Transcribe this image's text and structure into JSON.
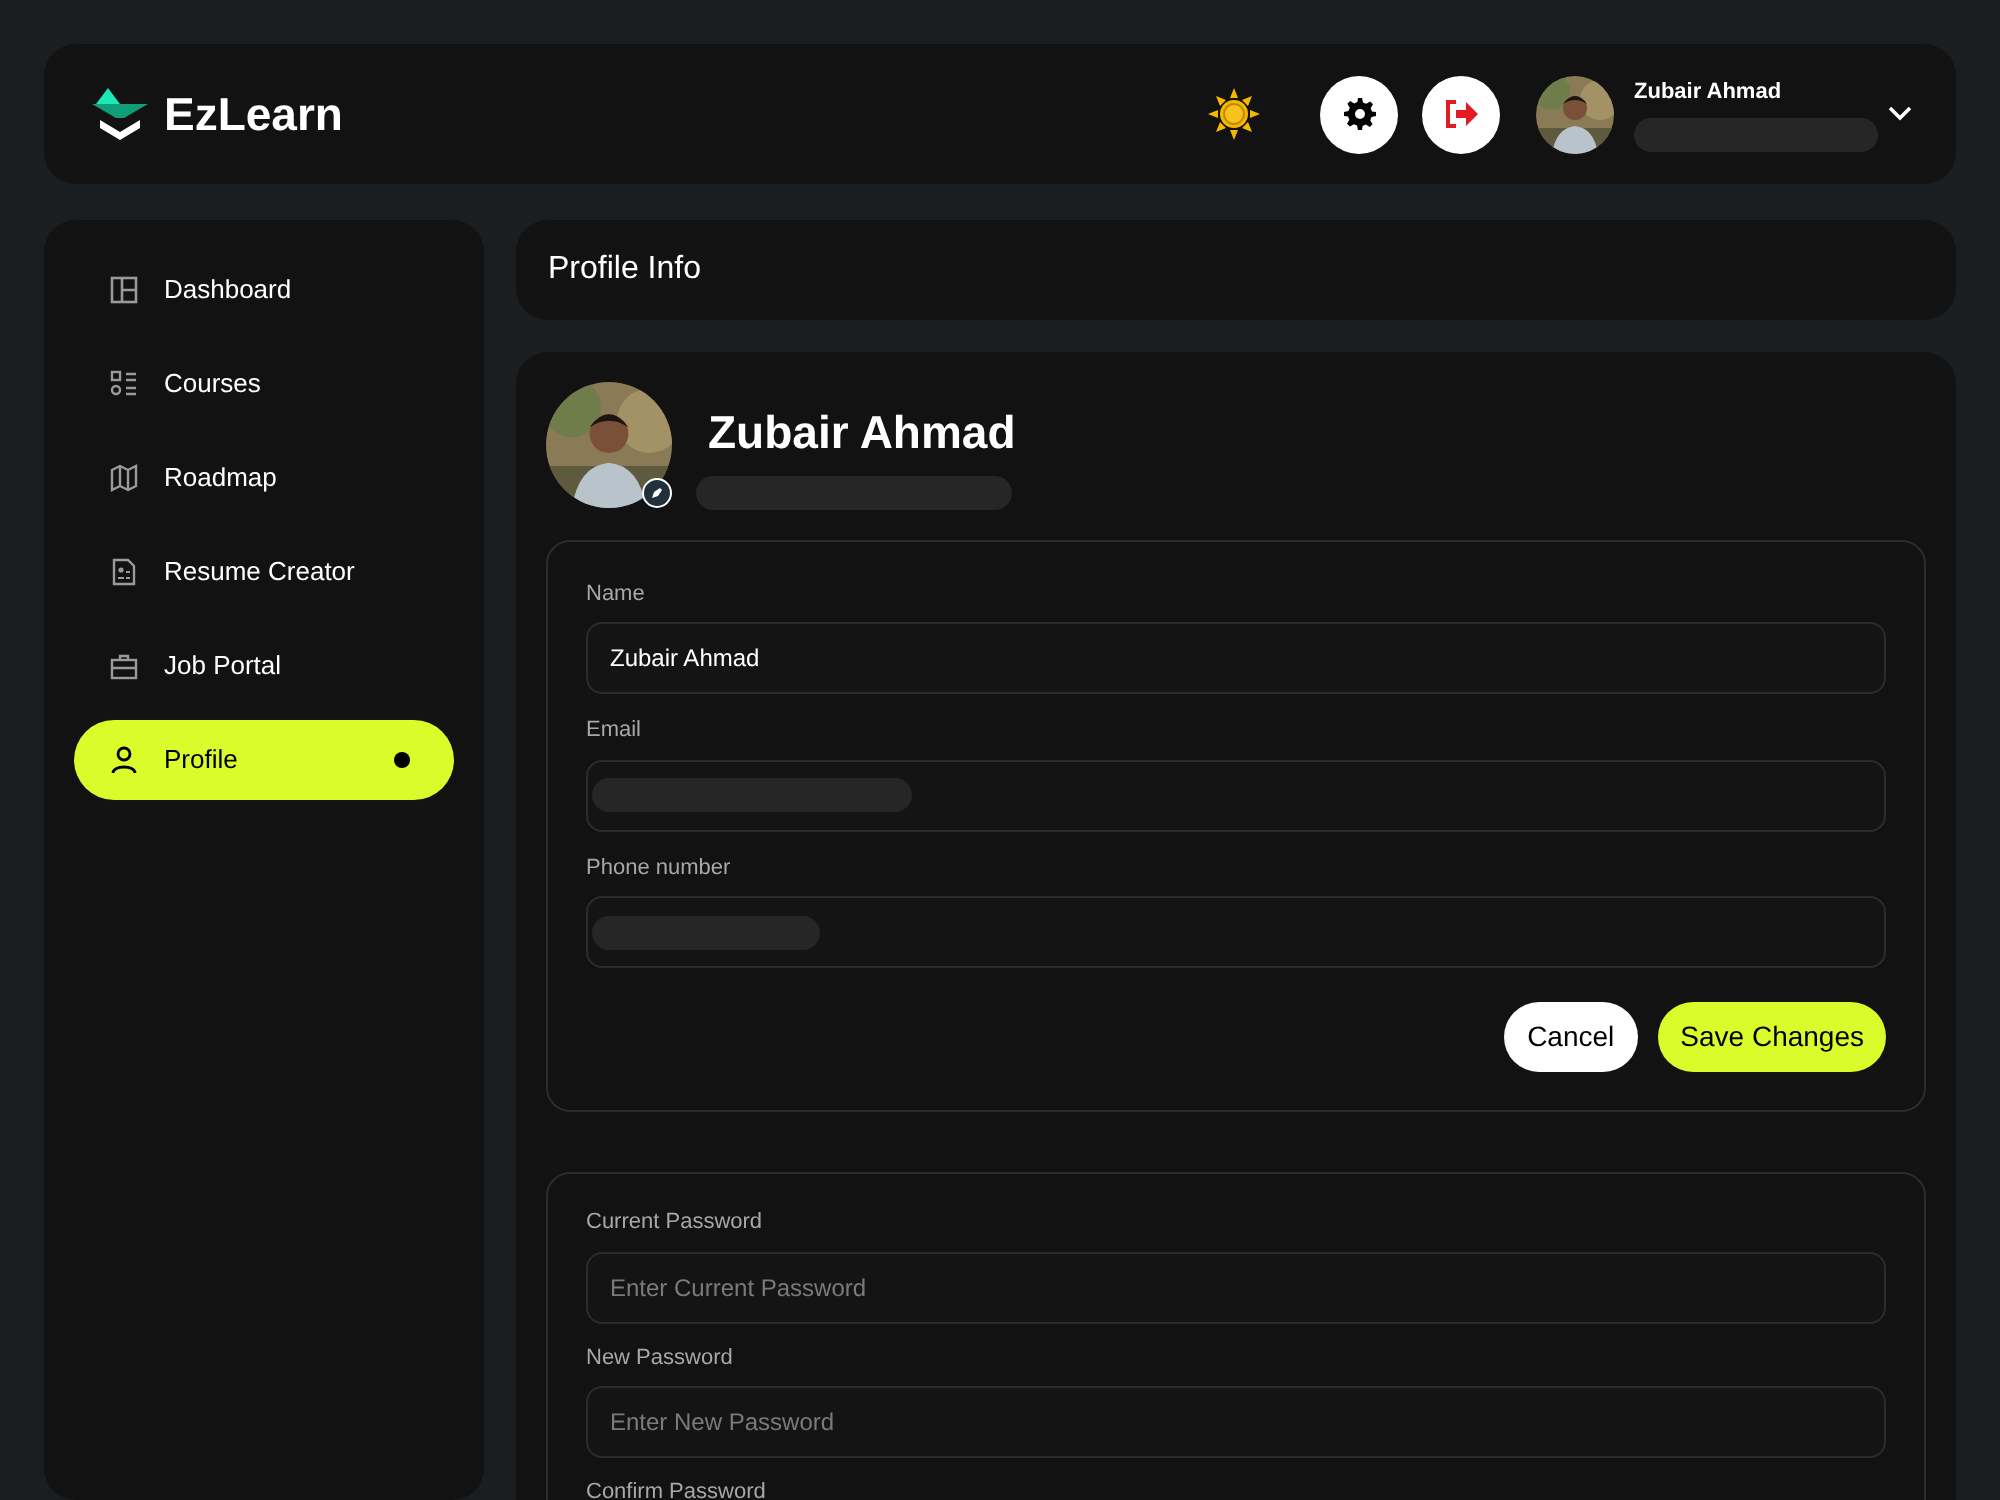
{
  "header": {
    "brand": "EzLearn",
    "user_name": "Zubair Ahmad",
    "user_detail_redacted": true
  },
  "sidebar": {
    "items": [
      {
        "label": "Dashboard",
        "selected": false
      },
      {
        "label": "Courses",
        "selected": false
      },
      {
        "label": "Roadmap",
        "selected": false
      },
      {
        "label": "Resume Creator",
        "selected": false
      },
      {
        "label": "Job Portal",
        "selected": false
      },
      {
        "label": "Profile",
        "selected": true
      }
    ]
  },
  "page_title": "Profile Info",
  "profile": {
    "name": "Zubair Ahmad",
    "subtitle_redacted": true
  },
  "info_form": {
    "fields": [
      {
        "label": "Name",
        "value": "Zubair Ahmad"
      },
      {
        "label": "Email",
        "redacted": true
      },
      {
        "label": "Phone number",
        "redacted": true
      }
    ],
    "buttons": [
      {
        "label": "Cancel",
        "kind": "secondary"
      },
      {
        "label": "Save Changes",
        "kind": "primary"
      }
    ]
  },
  "password_form": {
    "fields": [
      {
        "label": "Current Password",
        "placeholder": "Enter Current Password"
      },
      {
        "label": "New Password",
        "placeholder": "Enter New Password"
      },
      {
        "label": "Confirm Password"
      }
    ]
  }
}
